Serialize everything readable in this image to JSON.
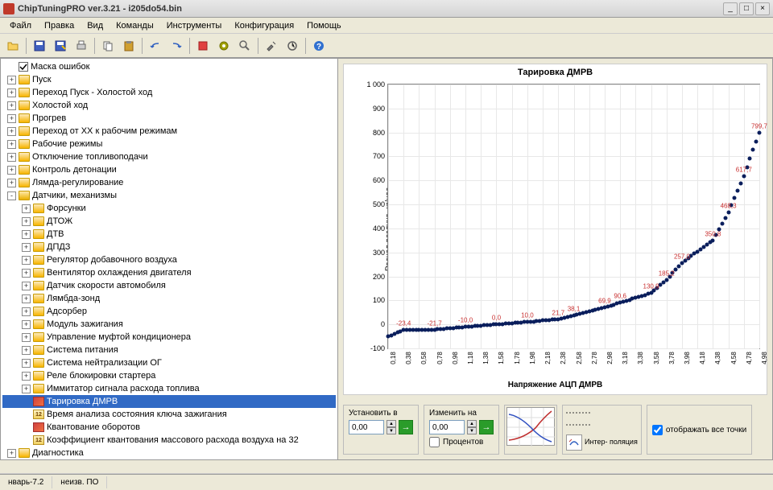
{
  "window": {
    "title": "ChipTuningPRO ver.3.21 - i205do54.bin"
  },
  "menu": [
    "Файл",
    "Правка",
    "Вид",
    "Команды",
    "Инструменты",
    "Конфигурация",
    "Помощь"
  ],
  "tree": [
    {
      "lvl": 0,
      "exp": "",
      "icon": "chk",
      "label": "Маска ошибок"
    },
    {
      "lvl": 0,
      "exp": "+",
      "icon": "folder",
      "label": "Пуск"
    },
    {
      "lvl": 0,
      "exp": "+",
      "icon": "folder",
      "label": "Переход Пуск - Холостой ход"
    },
    {
      "lvl": 0,
      "exp": "+",
      "icon": "folder",
      "label": "Холостой ход"
    },
    {
      "lvl": 0,
      "exp": "+",
      "icon": "folder",
      "label": "Прогрев"
    },
    {
      "lvl": 0,
      "exp": "+",
      "icon": "folder",
      "label": "Переход от ХХ к рабочим режимам"
    },
    {
      "lvl": 0,
      "exp": "+",
      "icon": "folder",
      "label": "Рабочие режимы"
    },
    {
      "lvl": 0,
      "exp": "+",
      "icon": "folder",
      "label": "Отключение топливоподачи"
    },
    {
      "lvl": 0,
      "exp": "+",
      "icon": "folder",
      "label": "Контроль детонации"
    },
    {
      "lvl": 0,
      "exp": "+",
      "icon": "folder",
      "label": "Лямда-регулирование"
    },
    {
      "lvl": 0,
      "exp": "-",
      "icon": "folder-open",
      "label": "Датчики, механизмы"
    },
    {
      "lvl": 1,
      "exp": "+",
      "icon": "folder",
      "label": "Форсунки"
    },
    {
      "lvl": 1,
      "exp": "+",
      "icon": "folder",
      "label": "ДТОЖ"
    },
    {
      "lvl": 1,
      "exp": "+",
      "icon": "folder",
      "label": "ДТВ"
    },
    {
      "lvl": 1,
      "exp": "+",
      "icon": "folder",
      "label": "ДПДЗ"
    },
    {
      "lvl": 1,
      "exp": "+",
      "icon": "folder",
      "label": "Регулятор добавочного воздуха"
    },
    {
      "lvl": 1,
      "exp": "+",
      "icon": "folder",
      "label": "Вентилятор охлаждения двигателя"
    },
    {
      "lvl": 1,
      "exp": "+",
      "icon": "folder",
      "label": "Датчик скорости автомобиля"
    },
    {
      "lvl": 1,
      "exp": "+",
      "icon": "folder",
      "label": "Лямбда-зонд"
    },
    {
      "lvl": 1,
      "exp": "+",
      "icon": "folder",
      "label": "Адсорбер"
    },
    {
      "lvl": 1,
      "exp": "+",
      "icon": "folder",
      "label": "Модуль зажигания"
    },
    {
      "lvl": 1,
      "exp": "+",
      "icon": "folder",
      "label": "Управление муфтой кондиционера"
    },
    {
      "lvl": 1,
      "exp": "+",
      "icon": "folder",
      "label": "Система питания"
    },
    {
      "lvl": 1,
      "exp": "+",
      "icon": "folder",
      "label": "Система нейтрализации ОГ"
    },
    {
      "lvl": 1,
      "exp": "+",
      "icon": "folder",
      "label": "Реле блокировки стартера"
    },
    {
      "lvl": 1,
      "exp": "+",
      "icon": "folder",
      "label": "Иммитатор сигнала расхода топлива"
    },
    {
      "lvl": 1,
      "exp": "",
      "icon": "chart",
      "label": "Тарировка ДМРВ",
      "sel": true
    },
    {
      "lvl": 1,
      "exp": "",
      "icon": "twelve",
      "label": "Время анализа состояния ключа зажигания"
    },
    {
      "lvl": 1,
      "exp": "",
      "icon": "chart",
      "label": "Квантование оборотов"
    },
    {
      "lvl": 1,
      "exp": "",
      "icon": "twelve",
      "label": "Коэффициент квантования массового расхода воздуха на 32"
    },
    {
      "lvl": 0,
      "exp": "+",
      "icon": "folder",
      "label": "Диагностика"
    }
  ],
  "chart_data": {
    "type": "line",
    "title": "Тарировка ДМРВ",
    "xlabel": "Напряжение АЦП ДМРВ",
    "ylabel": "Расход воздуха, кг/час",
    "ylim": [
      -100,
      1000
    ],
    "yticks": [
      -100,
      0,
      100,
      200,
      300,
      400,
      500,
      600,
      700,
      800,
      900,
      1000
    ],
    "xticks": [
      "0,18",
      "0,38",
      "0,58",
      "0,78",
      "0,98",
      "1,18",
      "1,38",
      "1,58",
      "1,78",
      "1,98",
      "2,18",
      "2,38",
      "2,58",
      "2,78",
      "2,98",
      "3,18",
      "3,38",
      "3,58",
      "3,78",
      "3,98",
      "4,18",
      "4,38",
      "4,58",
      "4,78",
      "4,98"
    ],
    "x": [
      0.18,
      0.38,
      0.58,
      0.78,
      0.98,
      1.18,
      1.38,
      1.58,
      1.78,
      1.98,
      2.18,
      2.38,
      2.58,
      2.78,
      2.98,
      3.18,
      3.38,
      3.58,
      3.78,
      3.98,
      4.18,
      4.38,
      4.58,
      4.78,
      4.98
    ],
    "values": [
      -50,
      -43,
      -35,
      -25,
      -10,
      0,
      0,
      0,
      6,
      15,
      24,
      38.1,
      52,
      69.9,
      90.6,
      108,
      130.9,
      160,
      185.2,
      220,
      257.0,
      300,
      350.8,
      380,
      468.3,
      540,
      617.7,
      700,
      799.7
    ],
    "labels_shown": [
      {
        "x": 0.38,
        "v": "-23,4"
      },
      {
        "x": 0.78,
        "v": "-21,7"
      },
      {
        "x": 1.18,
        "v": "-10,0"
      },
      {
        "x": 1.58,
        "v": "0,0"
      },
      {
        "x": 1.98,
        "v": "10,0"
      },
      {
        "x": 2.38,
        "v": "21,7"
      },
      {
        "x": 2.58,
        "v": "38,1"
      },
      {
        "x": 2.98,
        "v": "69,9"
      },
      {
        "x": 3.18,
        "v": "90,6"
      },
      {
        "x": 3.58,
        "v": "130,9"
      },
      {
        "x": 3.78,
        "v": "185,2"
      },
      {
        "x": 3.98,
        "v": "257,0"
      },
      {
        "x": 4.38,
        "v": "350,8"
      },
      {
        "x": 4.58,
        "v": "468,3"
      },
      {
        "x": 4.78,
        "v": "617,7"
      },
      {
        "x": 4.98,
        "v": "799,7"
      }
    ]
  },
  "controls": {
    "set_label": "Установить в",
    "set_value": "0,00",
    "change_label": "Изменить на",
    "change_value": "0,00",
    "percent_label": "Процентов",
    "interp_label": "Интер-\nполяция",
    "show_all_label": "отображать все точки"
  },
  "status": {
    "left": "нварь-7.2",
    "right": "неизв. ПО"
  }
}
